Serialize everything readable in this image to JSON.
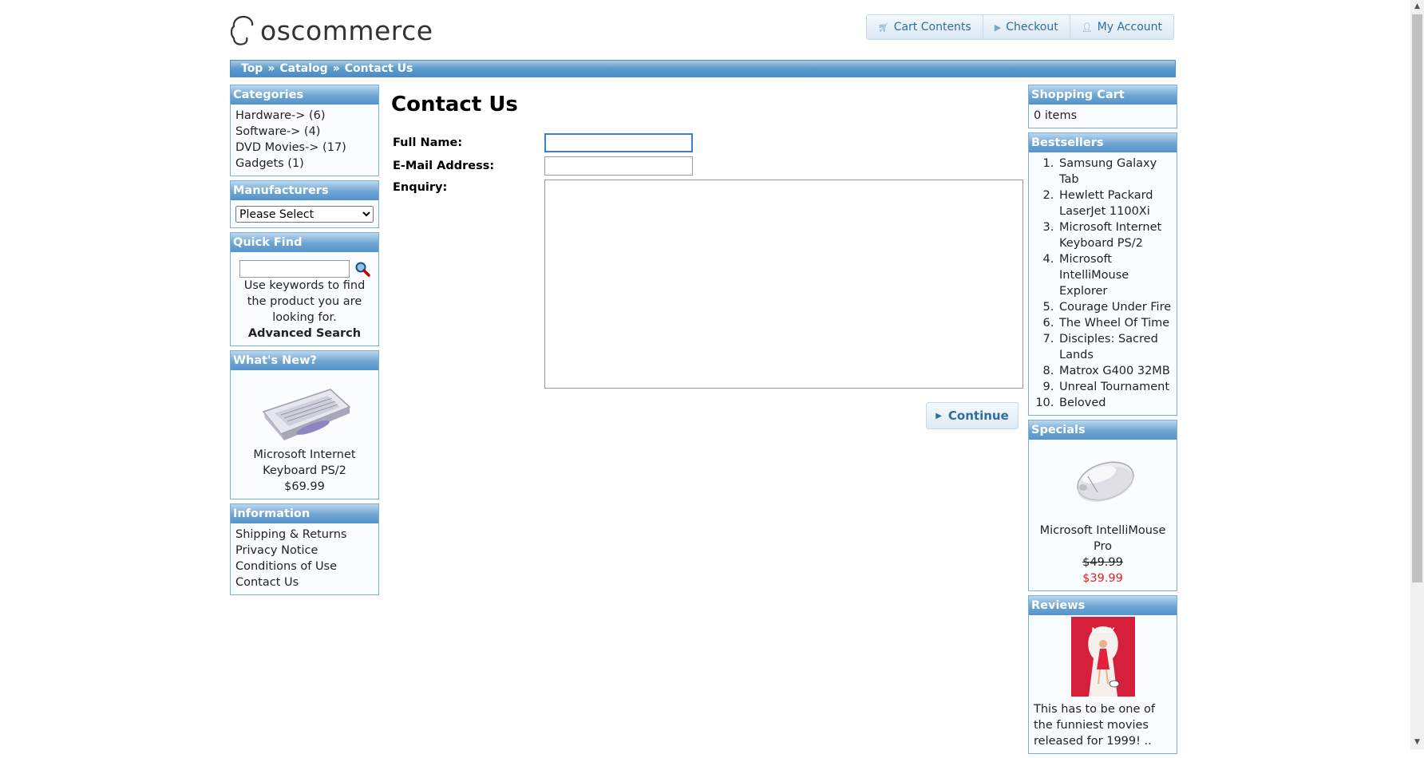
{
  "header": {
    "logo_text": "oscommerce",
    "nav": [
      {
        "label": "Cart Contents",
        "icon": "cart-icon"
      },
      {
        "label": "Checkout",
        "icon": "triangle-right-icon"
      },
      {
        "label": "My Account",
        "icon": "person-icon"
      }
    ]
  },
  "breadcrumb": [
    "Top",
    "Catalog",
    "Contact Us"
  ],
  "breadcrumb_sep": "»",
  "left": {
    "categories": {
      "title": "Categories",
      "items": [
        "Hardware-> (6)",
        "Software-> (4)",
        "DVD Movies-> (17)",
        "Gadgets (1)"
      ]
    },
    "manufacturers": {
      "title": "Manufacturers",
      "selected": "Please Select"
    },
    "quick_find": {
      "title": "Quick Find",
      "help": "Use keywords to find the product you are looking for.",
      "advanced": "Advanced Search"
    },
    "whats_new": {
      "title": "What's New?",
      "product": "Microsoft Internet Keyboard PS/2",
      "price": "$69.99"
    },
    "information": {
      "title": "Information",
      "items": [
        "Shipping & Returns",
        "Privacy Notice",
        "Conditions of Use",
        "Contact Us"
      ]
    }
  },
  "main": {
    "title": "Contact Us",
    "labels": {
      "full_name": "Full Name:",
      "email": "E-Mail Address:",
      "enquiry": "Enquiry:"
    },
    "values": {
      "full_name": "",
      "email": "",
      "enquiry": ""
    },
    "continue_label": "Continue"
  },
  "right": {
    "cart": {
      "title": "Shopping Cart",
      "text": "0 items"
    },
    "bestsellers": {
      "title": "Bestsellers",
      "items": [
        "Samsung Galaxy Tab",
        "Hewlett Packard LaserJet 1100Xi",
        "Microsoft Internet Keyboard PS/2",
        "Microsoft IntelliMouse Explorer",
        "Courage Under Fire",
        "The Wheel Of Time",
        "Disciples: Sacred Lands",
        "Matrox G400 32MB",
        "Unreal Tournament",
        "Beloved"
      ]
    },
    "specials": {
      "title": "Specials",
      "product": "Microsoft IntelliMouse Pro",
      "old_price": "$49.99",
      "new_price": "$39.99"
    },
    "reviews": {
      "title": "Reviews",
      "text": "This has to be one of the funniest movies released for 1999! ..",
      "poster_text": "MARY"
    }
  },
  "colors": {
    "accent": "#2e6e9e",
    "box_border": "#7ab0d6",
    "header_blue": "#5c9ccc",
    "sale_red": "#e52323"
  }
}
